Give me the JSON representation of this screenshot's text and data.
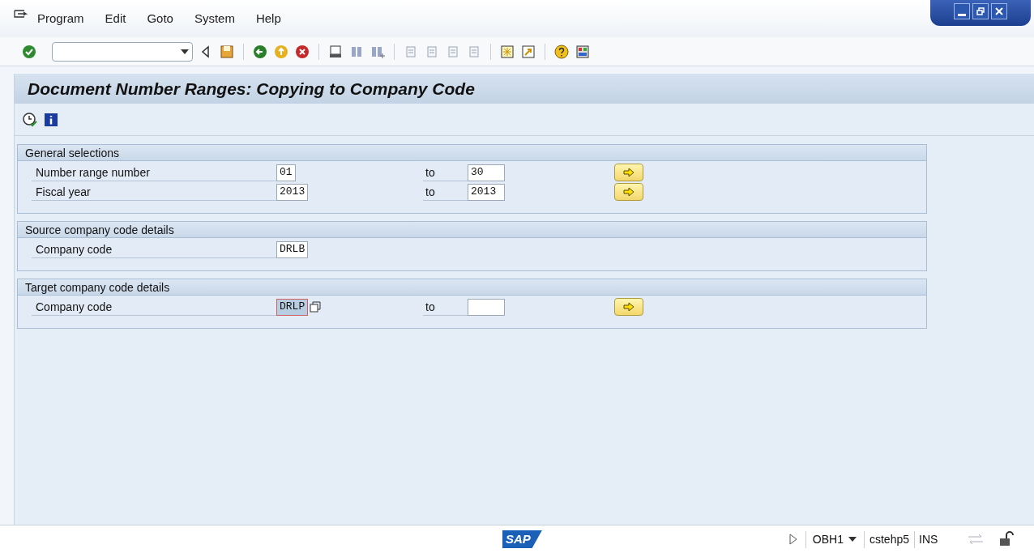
{
  "menu": [
    "Program",
    "Edit",
    "Goto",
    "System",
    "Help"
  ],
  "title": "Document Number Ranges: Copying to Company Code",
  "groups": [
    {
      "title": "General selections",
      "rows": [
        {
          "label": "Number range number",
          "from": "01",
          "to_label": "to",
          "to": "30",
          "focused": false,
          "more": true
        },
        {
          "label": "Fiscal year",
          "from": "2013",
          "to_label": "to",
          "to": "2013",
          "focused": false,
          "more": true
        }
      ]
    },
    {
      "title": "Source company code details",
      "rows": [
        {
          "label": "Company code",
          "from": "DRLB",
          "focused": false,
          "more": false
        }
      ]
    },
    {
      "title": "Target company code details",
      "rows": [
        {
          "label": "Company code",
          "from": "DRLP",
          "to_label": "to",
          "to": "",
          "focused": true,
          "more": true
        }
      ]
    }
  ],
  "status_bar": {
    "logo": "SAP",
    "transaction": "OBH1",
    "server": "cstehp5",
    "mode": "INS"
  }
}
